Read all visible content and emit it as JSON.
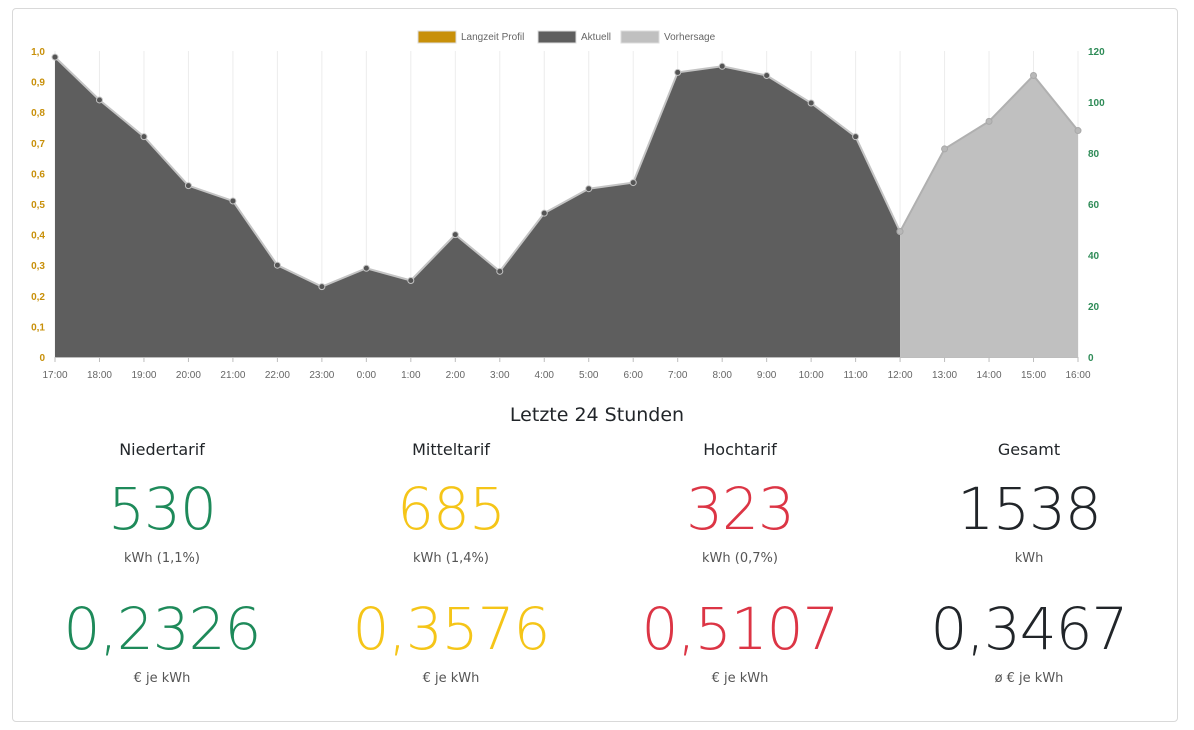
{
  "chart_data": {
    "type": "area",
    "legend": {
      "position": "top-center",
      "entries": [
        {
          "name": "Langzeit Profil",
          "color": "#c8900a"
        },
        {
          "name": "Aktuell",
          "color": "#5e5e5e"
        },
        {
          "name": "Vorhersage",
          "color": "#c0c0c0"
        }
      ]
    },
    "categories": [
      "17:00",
      "18:00",
      "19:00",
      "20:00",
      "21:00",
      "22:00",
      "23:00",
      "0:00",
      "1:00",
      "2:00",
      "3:00",
      "4:00",
      "5:00",
      "6:00",
      "7:00",
      "8:00",
      "9:00",
      "10:00",
      "11:00",
      "12:00",
      "13:00",
      "14:00",
      "15:00",
      "16:00"
    ],
    "left_axis": {
      "ticks": [
        "0",
        "0,1",
        "0,2",
        "0,3",
        "0,4",
        "0,5",
        "0,6",
        "0,7",
        "0,8",
        "0,9",
        "1,0"
      ],
      "range": [
        0,
        1.0
      ],
      "color": "#c8900a"
    },
    "right_axis": {
      "ticks": [
        "0",
        "20",
        "40",
        "60",
        "80",
        "100",
        "120"
      ],
      "range": [
        0,
        120
      ],
      "color": "#2e8b57"
    },
    "grid": "vertical",
    "series": [
      {
        "name": "Aktuell",
        "color": "#5e5e5e",
        "axis": "left",
        "values": [
          0.98,
          0.84,
          0.72,
          0.56,
          0.51,
          0.3,
          0.23,
          0.29,
          0.25,
          0.4,
          0.28,
          0.47,
          0.55,
          0.57,
          0.93,
          0.95,
          0.92,
          0.83,
          0.72,
          0.41
        ]
      },
      {
        "name": "Vorhersage",
        "color": "#c0c0c0",
        "axis": "left",
        "start_index": 19,
        "values": [
          0.41,
          0.68,
          0.77,
          0.92,
          0.74
        ]
      }
    ]
  },
  "summary": {
    "title": "Letzte 24 Stunden",
    "columns": [
      {
        "header": "Niedertarif",
        "kwh": "530",
        "kwh_unit": "kWh (1,1%)",
        "price": "0,2326",
        "price_unit": "€ je kWh",
        "color": "#1e8a5a"
      },
      {
        "header": "Mitteltarif",
        "kwh": "685",
        "kwh_unit": "kWh (1,4%)",
        "price": "0,3576",
        "price_unit": "€ je kWh",
        "color": "#f5c518"
      },
      {
        "header": "Hochtarif",
        "kwh": "323",
        "kwh_unit": "kWh (0,7%)",
        "price": "0,5107",
        "price_unit": "€ je kWh",
        "color": "#dc3545"
      },
      {
        "header": "Gesamt",
        "kwh": "1538",
        "kwh_unit": "kWh",
        "price": "0,3467",
        "price_unit": "ø € je kWh",
        "color": "#212529"
      }
    ]
  }
}
